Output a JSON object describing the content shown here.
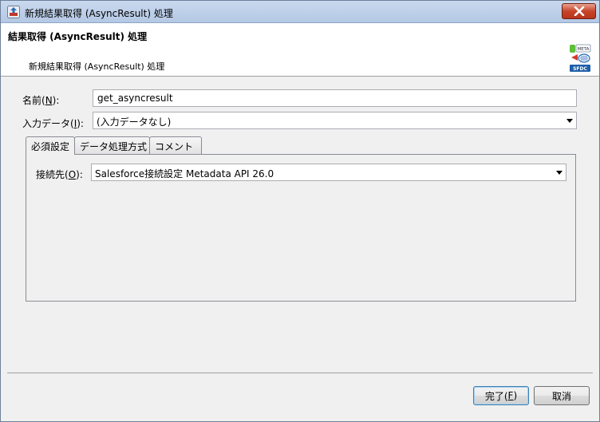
{
  "window": {
    "title": "新規結果取得 (AsyncResult) 処理",
    "close_icon": "close-icon"
  },
  "header": {
    "title": "結果取得 (AsyncResult) 処理",
    "description": "新規結果取得 (AsyncResult) 処理",
    "logo_icon": "sfdc-metadata-logo",
    "logo_text": "SFDC",
    "logo_meta_text": "META"
  },
  "form": {
    "name_label_prefix": "名前(",
    "name_label_key": "N",
    "name_label_suffix": "):",
    "name_value": "get_asyncresult",
    "input_label_prefix": "入力データ(",
    "input_label_key": "I",
    "input_label_suffix": "):",
    "input_value": "(入力データなし)"
  },
  "tabs": [
    {
      "label": "必須設定"
    },
    {
      "label": "データ処理方式"
    },
    {
      "label": "コメント"
    }
  ],
  "required_tab": {
    "connection_label_prefix": "接続先(",
    "connection_label_key": "O",
    "connection_label_suffix": "):",
    "connection_value": "Salesforce接続設定 Metadata API 26.0"
  },
  "footer": {
    "finish_label_prefix": "完了(",
    "finish_label_key": "F",
    "finish_label_suffix": ")",
    "cancel_label": "取消"
  },
  "colors": {
    "close_button": "#c7442a",
    "titlebar": "#c9d9ee"
  }
}
